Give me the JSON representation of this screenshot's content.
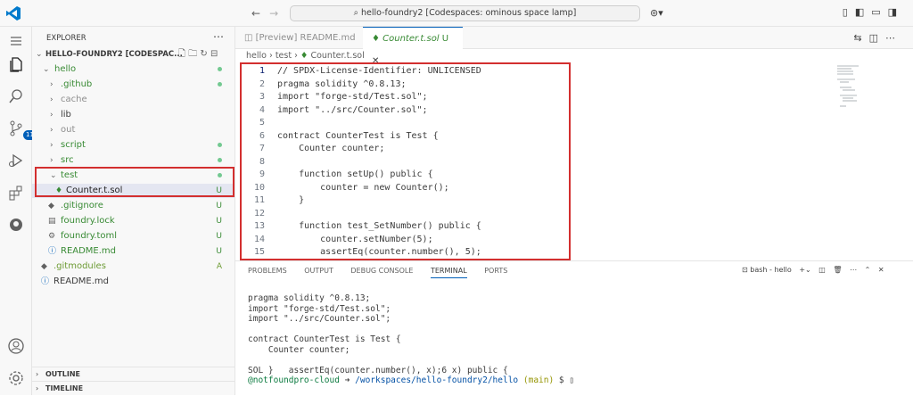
{
  "titlebar": {
    "command_center": "hello-foundry2 [Codespaces: ominous space lamp]"
  },
  "activity": {
    "badge": "11"
  },
  "sidebar": {
    "header": "EXPLORER",
    "root": "HELLO-FOUNDRY2 [CODESPAC...",
    "items": [
      {
        "label": "hello",
        "status": "dot"
      },
      {
        "label": ".github",
        "status": "dot"
      },
      {
        "label": "cache",
        "status": ""
      },
      {
        "label": "lib",
        "status": ""
      },
      {
        "label": "out",
        "status": ""
      },
      {
        "label": "script",
        "status": "dot"
      },
      {
        "label": "src",
        "status": "dot"
      },
      {
        "label": "test",
        "status": "dot"
      },
      {
        "label": "Counter.t.sol",
        "status": "U"
      },
      {
        "label": ".gitignore",
        "status": "U"
      },
      {
        "label": "foundry.lock",
        "status": "U"
      },
      {
        "label": "foundry.toml",
        "status": "U"
      },
      {
        "label": "README.md",
        "status": "U"
      },
      {
        "label": ".gitmodules",
        "status": "A"
      },
      {
        "label": "README.md",
        "status": ""
      }
    ],
    "outline": "OUTLINE",
    "timeline": "TIMELINE"
  },
  "editor": {
    "tabs": [
      {
        "label": "[Preview] README.md"
      },
      {
        "label": "Counter.t.sol",
        "status": "U"
      }
    ],
    "breadcrumb": {
      "p1": "hello",
      "p2": "test",
      "p3": "Counter.t.sol"
    },
    "lines": [
      "// SPDX-License-Identifier: UNLICENSED",
      "pragma solidity ^0.8.13;",
      "import \"forge-std/Test.sol\";",
      "import \"../src/Counter.sol\";",
      "",
      "contract CounterTest is Test {",
      "    Counter counter;",
      "",
      "    function setUp() public {",
      "        counter = new Counter();",
      "    }",
      "",
      "    function test_SetNumber() public {",
      "        counter.setNumber(5);",
      "        assertEq(counter.number(), 5);"
    ]
  },
  "panel": {
    "tabs": [
      "PROBLEMS",
      "OUTPUT",
      "DEBUG CONSOLE",
      "TERMINAL",
      "PORTS"
    ],
    "terminal_name": "bash - hello",
    "terminal_lines": [
      "pragma solidity ^0.8.13;",
      "import \"forge-std/Test.sol\";",
      "import \"../src/Counter.sol\";",
      "",
      "contract CounterTest is Test {",
      "    Counter counter;",
      "",
      "SOL }   assertEq(counter.number(), x);6 x) public {"
    ],
    "prompt": {
      "user": "@notfoundpro-cloud",
      "arrow": "➜",
      "path": "/workspaces/hello-foundry2/hello",
      "branch": "(main)",
      "symbol": "$"
    }
  }
}
